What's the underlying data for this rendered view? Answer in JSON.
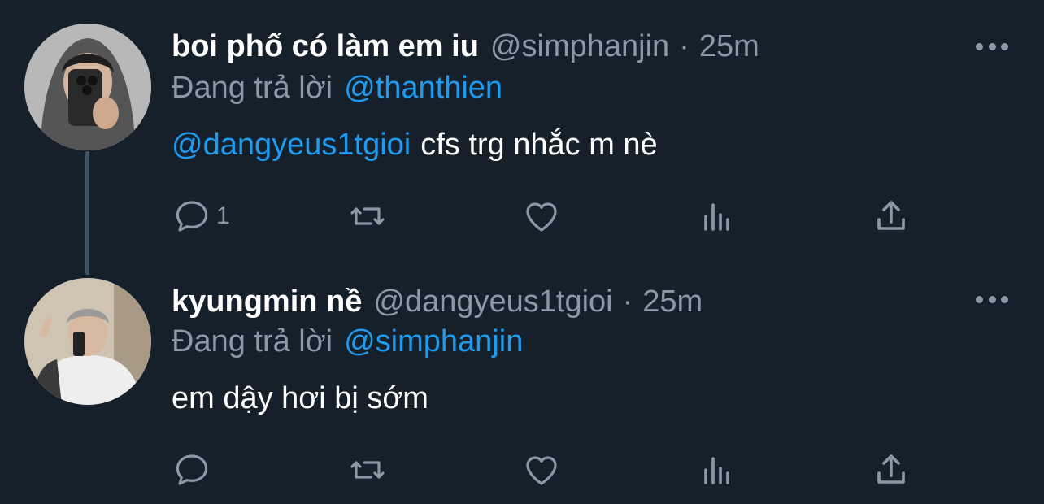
{
  "tweets": [
    {
      "display_name": "boi phố có làm em iu",
      "handle": "@simphanjin",
      "separator": "·",
      "time": "25m",
      "reply_prefix": "Đang trả lời",
      "reply_to": "@thanthien",
      "body_mention": "@dangyeus1tgioi",
      "body_text": "cfs trg nhắc m nè",
      "reply_count": "1",
      "avatar_icon": "avatar-photo"
    },
    {
      "display_name": "kyungmin nề",
      "handle": "@dangyeus1tgioi",
      "separator": "·",
      "time": "25m",
      "reply_prefix": "Đang trả lời",
      "reply_to": "@simphanjin",
      "body_mention": "",
      "body_text": "em dậy hơi bị sớm",
      "reply_count": "",
      "avatar_icon": "avatar-photo"
    }
  ],
  "icons": [
    "reply-icon",
    "retweet-icon",
    "like-icon",
    "views-icon",
    "share-icon",
    "more-icon"
  ],
  "colors": {
    "background": "#15202b",
    "accent": "#1d9bf0",
    "muted": "#8b98a5",
    "text": "#ffffff"
  }
}
